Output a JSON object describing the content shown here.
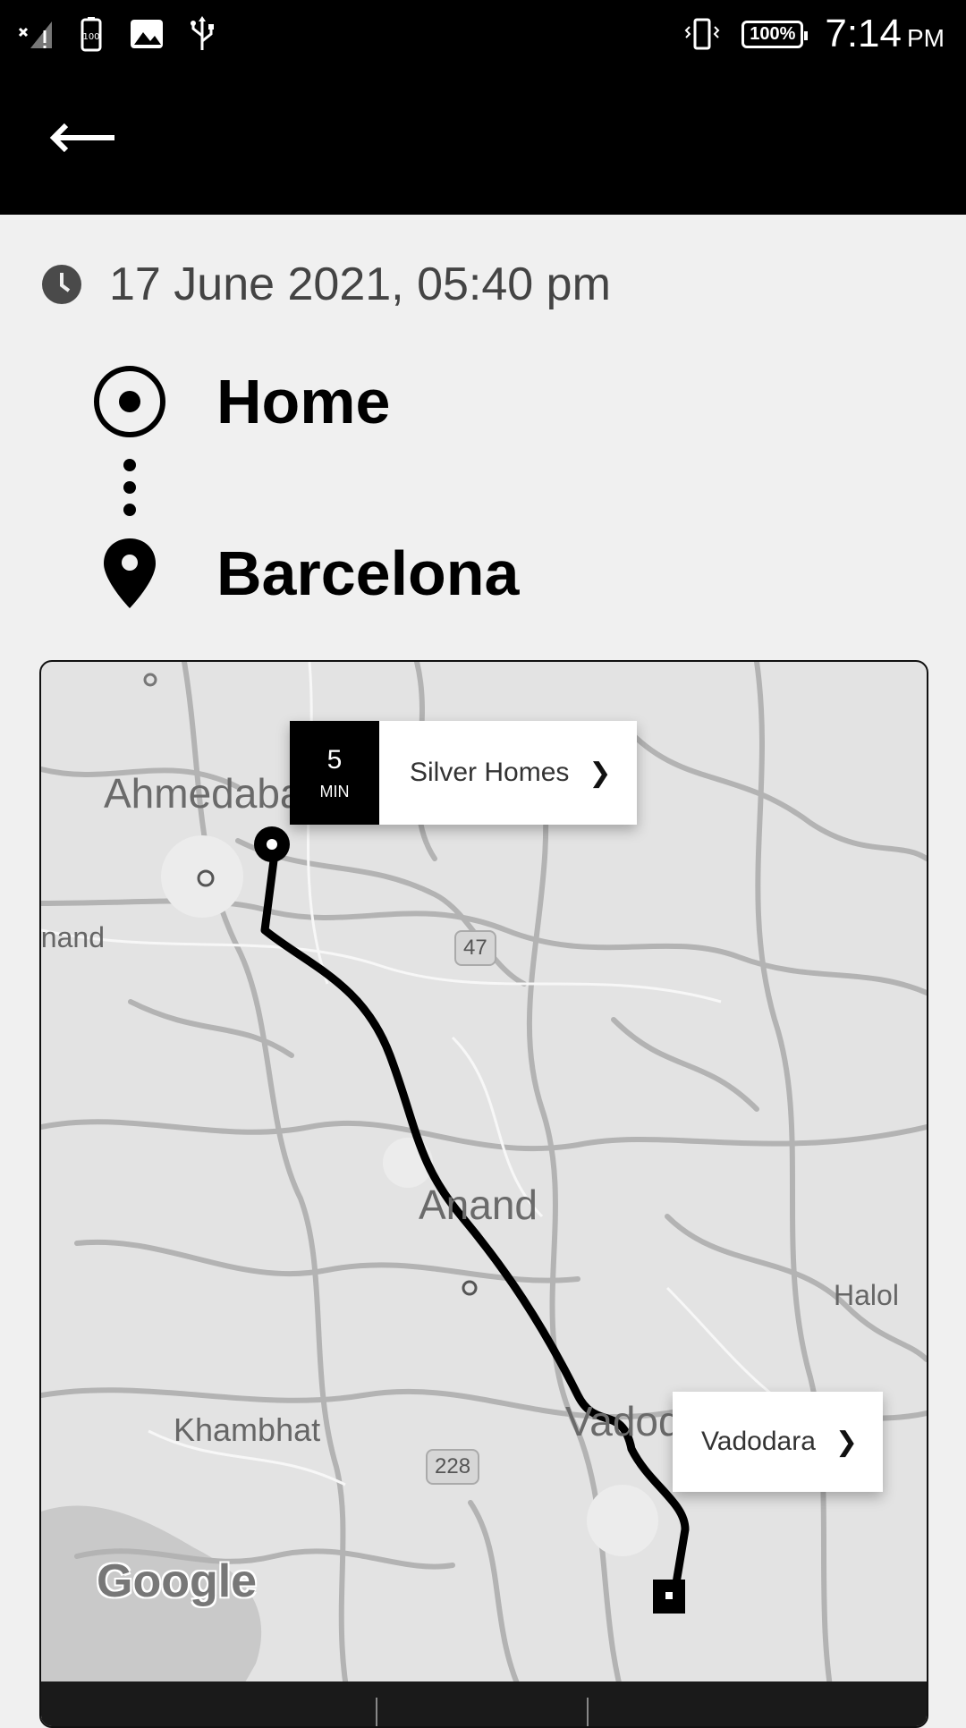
{
  "status_bar": {
    "time": "7:14",
    "ampm": "PM",
    "battery": "100%",
    "icons": [
      "signal-off-icon",
      "battery-100-icon",
      "image-icon",
      "usb-icon",
      "vibrate-icon"
    ]
  },
  "app_bar": {
    "back_icon": "arrow-left-icon"
  },
  "trip": {
    "datetime": "17 June 2021, 05:40 pm",
    "pickup": "Home",
    "dropoff": "Barcelona"
  },
  "map": {
    "pickup_callout": {
      "eta_value": "5",
      "eta_unit": "MIN",
      "label": "Silver Homes"
    },
    "dropoff_callout": {
      "label": "Vadodara"
    },
    "chevron": "❯",
    "cities": {
      "ahmedabad": "Ahmedabad",
      "anand_left": "anand",
      "anand": "Anand",
      "halol": "Halol",
      "khambhat": "Khambhat",
      "vadodara": "Vadodara"
    },
    "route_shields": {
      "r47": "47",
      "r228": "228"
    },
    "attribution": "Google"
  }
}
